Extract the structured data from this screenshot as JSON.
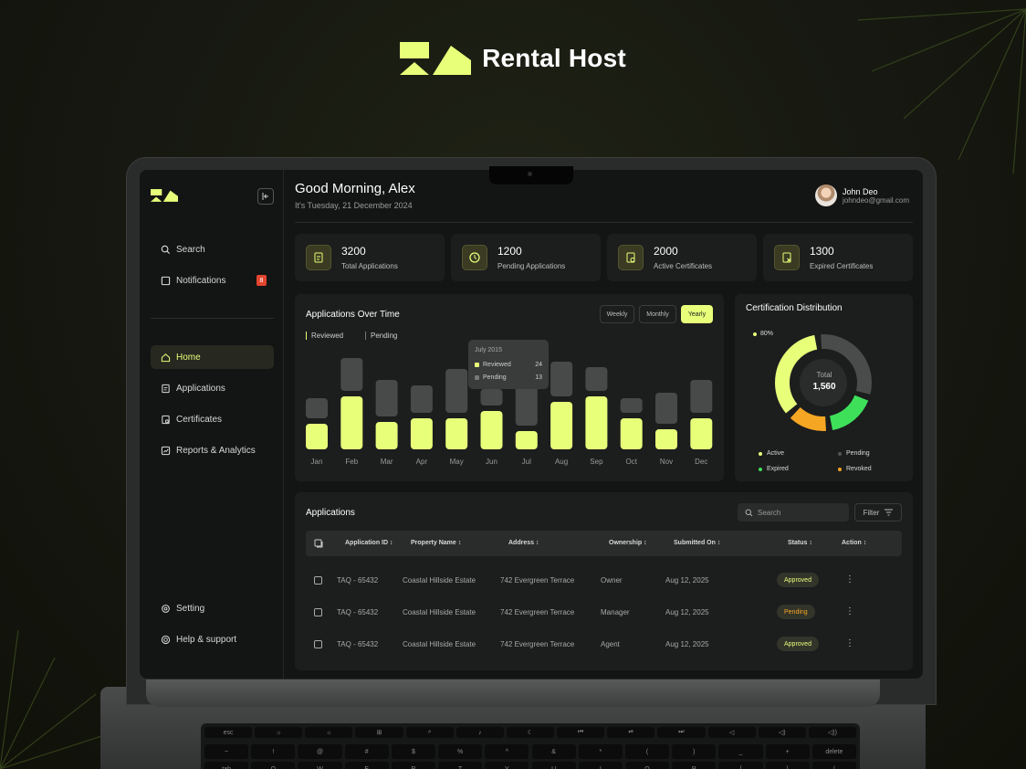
{
  "brand": {
    "name": "Rental Host"
  },
  "sidebar": {
    "items_top": [
      {
        "label": "Search",
        "icon": "search-icon"
      },
      {
        "label": "Notifications",
        "icon": "bell-icon",
        "badge": "8"
      }
    ],
    "items_nav": [
      {
        "label": "Home",
        "icon": "home-icon"
      },
      {
        "label": "Applications",
        "icon": "document-icon"
      },
      {
        "label": "Certificates",
        "icon": "certificate-icon"
      },
      {
        "label": "Reports & Analytics",
        "icon": "analytics-icon"
      }
    ],
    "items_bottom": [
      {
        "label": "Setting",
        "icon": "gear-icon"
      },
      {
        "label": "Help & support",
        "icon": "help-icon"
      }
    ]
  },
  "header": {
    "greeting": "Good Morning, Alex",
    "date": "It's Tuesday, 21 December 2024",
    "user_name": "John Deo",
    "user_email": "johndeo@gmail.com"
  },
  "stats": [
    {
      "value": "3200",
      "label": "Total Applications"
    },
    {
      "value": "1200",
      "label": "Pending Applications"
    },
    {
      "value": "2000",
      "label": "Active Certificates"
    },
    {
      "value": "1300",
      "label": "Expired Certificates"
    }
  ],
  "applications_chart": {
    "title": "Applications Over Time",
    "toggles": [
      "Weekly",
      "Monthly",
      "Yearly"
    ],
    "selected_toggle": "Yearly",
    "tooltip": {
      "title": "July 2015",
      "rows": [
        {
          "label": "Reviewed",
          "value": "24"
        },
        {
          "label": "Pending",
          "value": "13"
        }
      ]
    }
  },
  "chart_data": [
    {
      "type": "bar",
      "categories": [
        "Jan",
        "Feb",
        "Mar",
        "Apr",
        "May",
        "Jun",
        "Jul",
        "Aug",
        "Sep",
        "Oct",
        "Nov",
        "Dec"
      ],
      "series": [
        {
          "name": "Reviewed",
          "values": [
            28,
            58,
            30,
            34,
            34,
            42,
            20,
            52,
            58,
            34,
            22,
            34
          ]
        },
        {
          "name": "Pending",
          "values": [
            22,
            36,
            40,
            30,
            48,
            18,
            46,
            38,
            26,
            16,
            34,
            36
          ]
        }
      ],
      "colors": {
        "Reviewed": "#e8ff7a",
        "Pending": "#484949"
      },
      "legend": "top-left",
      "grid": false
    },
    {
      "type": "pie",
      "title": "Certification Distribution",
      "center_label": "Total",
      "center_value": "1,560",
      "callout": "80%",
      "categories": [
        "Active",
        "Pending",
        "Expired",
        "Revoked"
      ],
      "values": [
        35,
        32,
        18,
        15
      ],
      "colors": [
        "#e8ff7a",
        "#4a4b4b",
        "#3ee05a",
        "#f5a623"
      ],
      "legend": "bottom"
    }
  ],
  "applications_table": {
    "title": "Applications",
    "search_placeholder": "Search",
    "filter_label": "Filter",
    "columns": [
      "Application ID",
      "Property Name",
      "Address",
      "Ownership",
      "Submitted On",
      "Status",
      "Action"
    ],
    "rows": [
      {
        "id": "TAQ - 65432",
        "property": "Coastal Hillside Estate",
        "address": "742 Evergreen Terrace",
        "ownership": "Owner",
        "submitted": "Aug 12, 2025",
        "status": "Approved"
      },
      {
        "id": "TAQ - 65432",
        "property": "Coastal Hillside Estate",
        "address": "742 Evergreen Terrace",
        "ownership": "Manager",
        "submitted": "Aug 12, 2025",
        "status": "Pending"
      },
      {
        "id": "TAQ - 65432",
        "property": "Coastal Hillside Estate",
        "address": "742 Evergreen Terrace",
        "ownership": "Agent",
        "submitted": "Aug 12, 2025",
        "status": "Approved"
      }
    ]
  },
  "keyboard": {
    "row1": [
      "esc",
      "☼",
      "☼",
      "⊞",
      "⌕",
      "♪",
      "☾",
      "⏮",
      "⏯",
      "⏭",
      "◁",
      "◁)",
      "◁))"
    ],
    "row2": [
      "~",
      "!",
      "@",
      "#",
      "$",
      "%",
      "^",
      "&",
      "*",
      "(",
      ")",
      "_",
      "+",
      "delete"
    ],
    "row3": [
      "tab",
      "Q",
      "W",
      "E",
      "R",
      "T",
      "Y",
      "U",
      "I",
      "O",
      "P",
      "{",
      "}",
      "|"
    ]
  }
}
